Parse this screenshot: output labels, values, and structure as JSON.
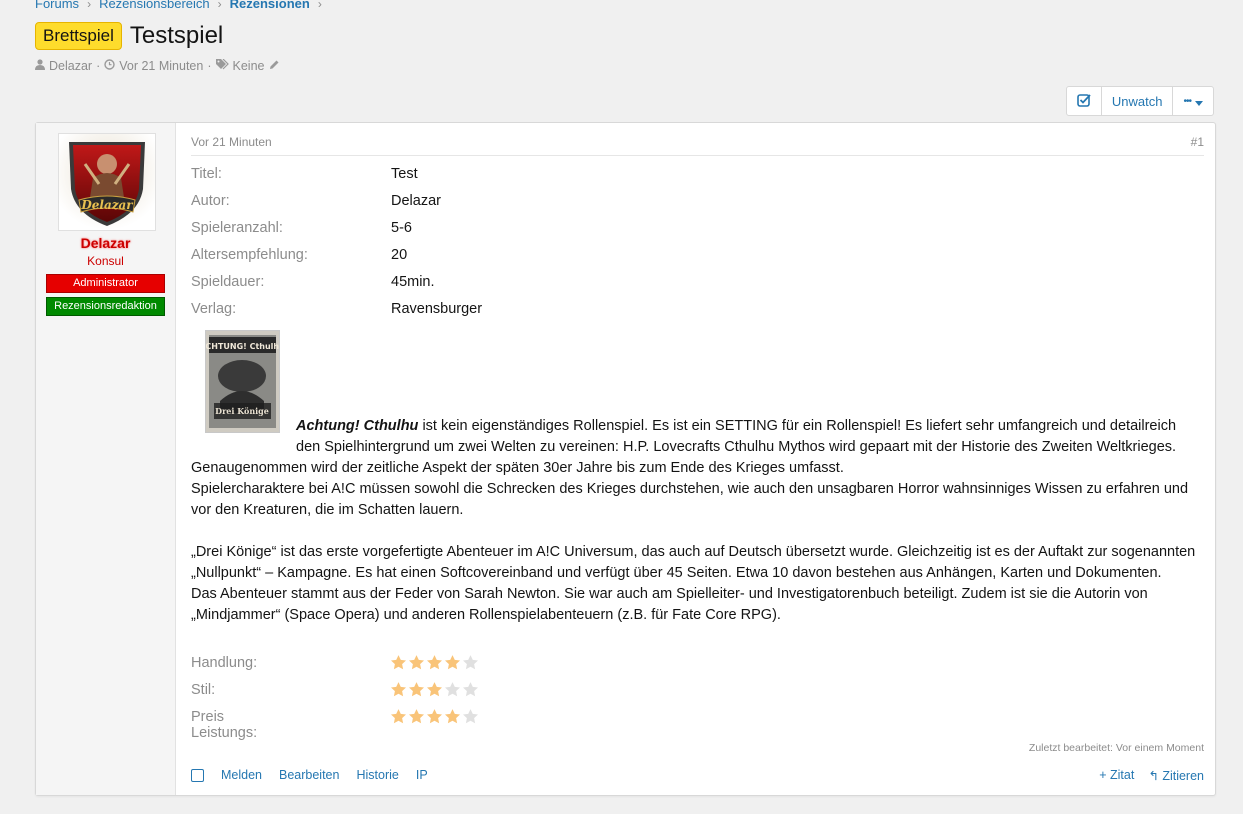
{
  "breadcrumb": {
    "items": [
      "Forums",
      "Rezensionsbereich",
      "Rezensionen"
    ]
  },
  "thread": {
    "prefix": "Brettspiel",
    "title": "Testspiel",
    "author": "Delazar",
    "time": "Vor 21 Minuten",
    "tags": "Keine"
  },
  "actions": {
    "watch_label": "Unwatch",
    "more_label": "•••"
  },
  "post": {
    "date": "Vor 21 Minuten",
    "number": "#1",
    "user": {
      "name": "Delazar",
      "title": "Konsul",
      "avatar_text": "Delazar",
      "banners": [
        "Administrator",
        "Rezensionsredaktion"
      ]
    },
    "fields": [
      {
        "label": "Titel:",
        "value": "Test"
      },
      {
        "label": "Autor:",
        "value": "Delazar"
      },
      {
        "label": "Spieleranzahl:",
        "value": "5-6"
      },
      {
        "label": "Altersempfehlung:",
        "value": "20"
      },
      {
        "label": "Spieldauer:",
        "value": "45min."
      },
      {
        "label": "Verlag:",
        "value": "Ravensburger"
      }
    ],
    "cover": {
      "title_top": "ACHTUNG! Cthulhu",
      "title_bottom": "Drei Könige"
    },
    "body": {
      "lead_em": "Achtung! Cthulhu",
      "para1_rest": " ist kein eigenständiges Rollenspiel. Es ist ein SETTING für ein Rollenspiel! Es liefert sehr umfangreich und detailreich den Spielhintergrund um zwei Welten zu vereinen: H.P. Lovecrafts Cthulhu Mythos wird gepaart mit der Historie des Zweiten Weltkrieges.",
      "para2": "Genaugenommen wird der zeitliche Aspekt der späten 30er Jahre bis zum Ende des Krieges umfasst.",
      "para3": "Spielercharaktere bei A!C müssen sowohl die Schrecken des Krieges durchstehen, wie auch den unsagbaren Horror wahnsinniges Wissen zu erfahren und vor den Kreaturen, die im Schatten lauern.",
      "para4": "„Drei Könige“ ist das erste vorgefertigte Abenteuer im A!C Universum, das auch auf Deutsch übersetzt wurde. Gleichzeitig ist es der Auftakt zur sogenannten „Nullpunkt“ – Kampagne. Es hat einen Softcovereinband und verfügt über 45 Seiten. Etwa 10 davon bestehen aus Anhängen, Karten und Dokumenten.",
      "para5": "Das Abenteuer stammt aus der Feder von Sarah Newton. Sie war auch am Spielleiter- und Investigatorenbuch beteiligt. Zudem ist sie die Autorin von „Mindjammer“ (Space Opera) und anderen Rollenspielabenteuern (z.B. für Fate Core RPG)."
    },
    "ratings": [
      {
        "label": "Handlung:",
        "value": 4,
        "max": 5
      },
      {
        "label": "Stil:",
        "value": 3,
        "max": 5
      },
      {
        "label": "Preis Leistungs:",
        "value": 4,
        "max": 5
      }
    ],
    "edited": "Zuletzt bearbeitet: Vor einem Moment",
    "footer_left": [
      "Melden",
      "Bearbeiten",
      "Historie",
      "IP"
    ],
    "footer_right": [
      "+ Zitat",
      "Zitieren"
    ]
  },
  "colors": {
    "link": "#2577b1",
    "prefix_bg": "#fedc2c",
    "username": "#cc0000",
    "star_on": "#f9c479",
    "star_off": "#e0e0e0"
  }
}
